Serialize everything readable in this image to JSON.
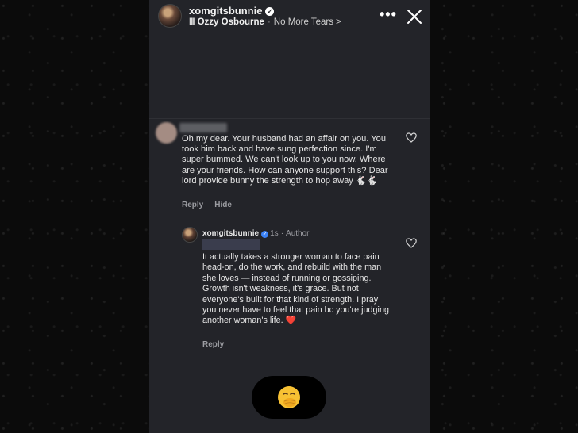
{
  "story": {
    "username": "xomgitsbunnie",
    "music": {
      "bars": "III",
      "artist": "Ozzy Osbourne",
      "separator": "·",
      "song": "No More Tears",
      "chevron": ">"
    },
    "more": "•••"
  },
  "comments": [
    {
      "text": "Oh my dear. Your husband had an affair on you. You took him back and have sung perfection since. I'm super bummed. We can't look up to you now. Where are your friends. How can anyone support this? Dear lord provide bunny the strength to hop away 🐇🐇",
      "actions": [
        "Reply",
        "Hide"
      ]
    },
    {
      "username": "xomgitsbunnie",
      "time": "1s",
      "separator": "·",
      "role": "Author",
      "text": "It actually takes a stronger woman to face pain head-on, do the work, and rebuild with the man she loves — instead of running or gossiping. Growth isn't weakness, it's grace. But not everyone's built for that kind of strength. I pray you never have to feel that pain bc you're judging another woman's life. ❤️",
      "actions": [
        "Reply"
      ]
    }
  ],
  "icons": {
    "verified": "verified-badge-icon",
    "heart": "heart-outline-icon",
    "close": "close-icon",
    "reaction": "face-with-hand-over-mouth-emoji"
  },
  "colors": {
    "panel": "#232429",
    "background": "#0b0b0b",
    "verified_blue": "#3b82f6",
    "muted": "#9b9ca1"
  }
}
